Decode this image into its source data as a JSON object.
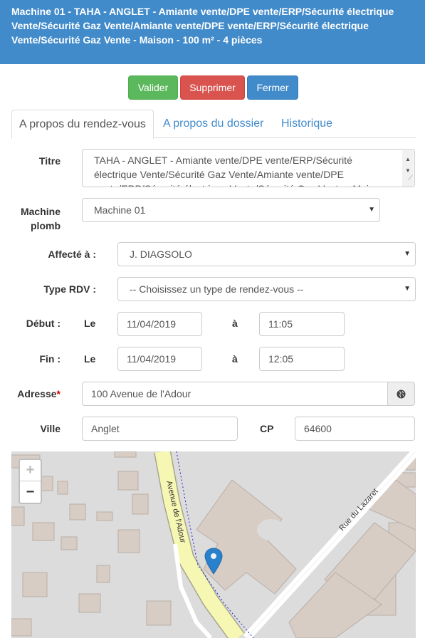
{
  "header": {
    "line1": "Machine 01 - TAHA - ANGLET - Amiante vente/DPE vente/ERP/Sécurité électrique",
    "line2": "Vente/Sécurité Gaz Vente/Amiante vente/DPE vente/ERP/Sécurité électrique",
    "line3": "Vente/Sécurité Gaz Vente - Maison - 100 m² - 4 pièces"
  },
  "buttons": {
    "valider": "Valider",
    "supprimer": "Supprimer",
    "fermer": "Fermer"
  },
  "tabs": [
    "A propos du rendez-vous",
    "A propos du dossier",
    "Historique"
  ],
  "form": {
    "titre_label": "Titre",
    "titre_line1": "TAHA - ANGLET - Amiante vente/DPE vente/ERP/Sécurité",
    "titre_line2": "électrique Vente/Sécurité Gaz Vente/Amiante vente/DPE",
    "titre_line3": "vente/ERP/Sécurité électrique Vente/Sécurité Gaz Vente - Maison",
    "machine_label_1": "Machine",
    "machine_label_2": "plomb",
    "machine_value": "Machine 01",
    "affecte_label": "Affecté à :",
    "affecte_value": "J. DIAGSOLO",
    "type_label": "Type RDV :",
    "type_value": "-- Choisissez un type de rendez-vous --",
    "debut_label": "Début :",
    "fin_label": "Fin :",
    "le": "Le",
    "a": "à",
    "debut_date": "11/04/2019",
    "debut_time": "11:05",
    "fin_date": "11/04/2019",
    "fin_time": "12:05",
    "adresse_label": "Adresse",
    "adresse_required": "*",
    "adresse_value": "100 Avenue de l'Adour",
    "ville_label": "Ville",
    "ville_value": "Anglet",
    "cp_label": "CP",
    "cp_value": "64600"
  },
  "map": {
    "zoom_in": "+",
    "zoom_out": "−",
    "street1": "Avenue de l'Adour",
    "street2": "Rue du Lazaret"
  },
  "icons": {
    "globe": "globe-icon",
    "marker": "map-marker-icon",
    "dropdown": "caret-down-icon"
  }
}
